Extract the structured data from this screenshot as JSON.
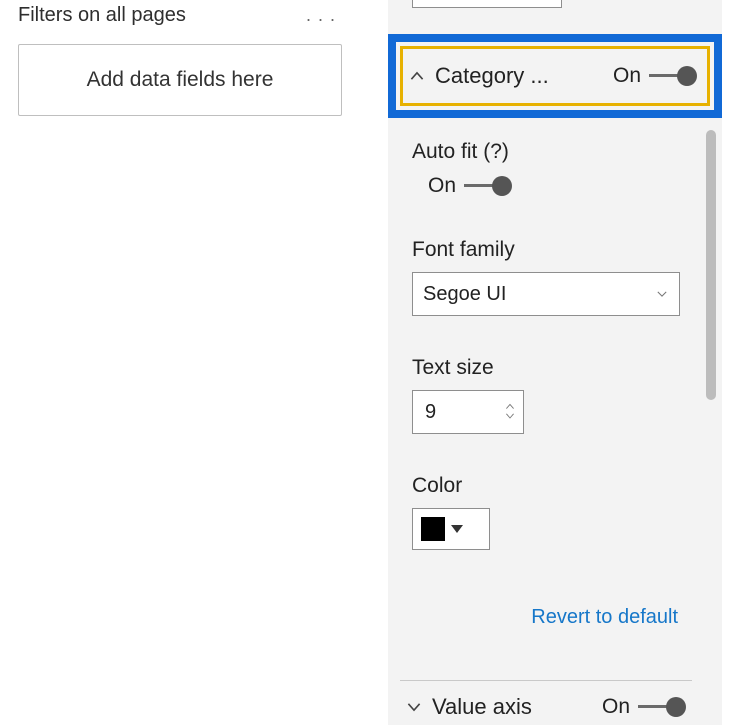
{
  "filters": {
    "title": "Filters on all pages",
    "drop_placeholder": "Add data fields here"
  },
  "format": {
    "category": {
      "label": "Category ...",
      "toggle_text": "On"
    },
    "autofit": {
      "label": "Auto fit (?)",
      "toggle_text": "On"
    },
    "font_family": {
      "label": "Font family",
      "value": "Segoe UI"
    },
    "text_size": {
      "label": "Text size",
      "value": "9"
    },
    "color": {
      "label": "Color",
      "swatch": "#000000"
    },
    "revert": "Revert to default",
    "value_axis": {
      "label": "Value axis",
      "toggle_text": "On"
    }
  }
}
